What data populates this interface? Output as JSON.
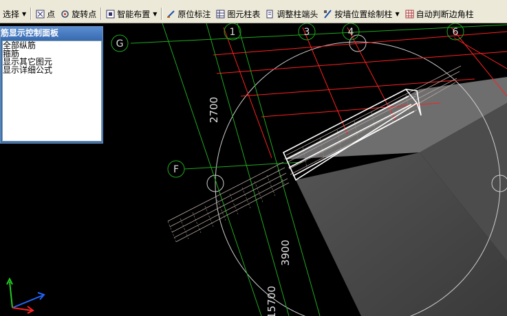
{
  "toolbar": {
    "select_label": "选择",
    "point_label": "点",
    "rotate_point_label": "旋转点",
    "smart_layout_label": "智能布置",
    "original_annotation_label": "原位标注",
    "element_column_table_label": "图元柱表",
    "adjust_column_end_label": "调整柱端头",
    "draw_by_wall_label": "按墙位置绘制柱",
    "auto_corner_label": "自动判断边角柱"
  },
  "panel": {
    "title": "筋显示控制面板",
    "items": [
      "全部纵筋",
      "箍筋",
      "显示其它图元",
      "显示详细公式"
    ]
  },
  "axes": {
    "grid_labels": [
      "G",
      "F",
      "1",
      "3",
      "4",
      "6"
    ],
    "dimension_labels": [
      "2700",
      "3900",
      "15700"
    ]
  },
  "colors": {
    "grid_red": "#ff2020",
    "grid_green": "#1faa1f",
    "background": "#000000",
    "panel_blue": "#3a6ea5"
  }
}
